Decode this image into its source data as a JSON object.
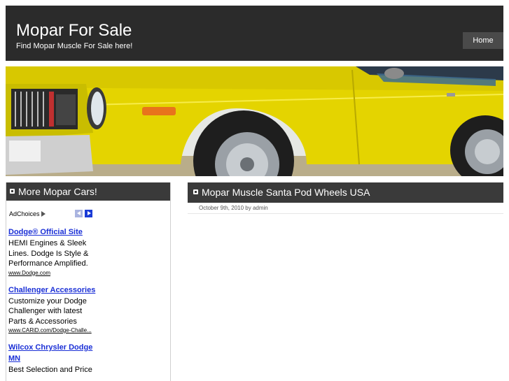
{
  "header": {
    "site_title": "Mopar For Sale",
    "site_description": "Find Mopar Muscle For Sale here!",
    "nav": {
      "home": "Home"
    }
  },
  "sidebar": {
    "heading": "More Mopar Cars!",
    "adchoices_label": "AdChoices",
    "ads": [
      {
        "title": "Dodge® Official Site",
        "body": "HEMI Engines & Sleek Lines. Dodge Is Style & Performance Amplified.",
        "url": "www.Dodge.com"
      },
      {
        "title": "Challenger Accessories",
        "body": "Customize your Dodge Challenger with latest Parts & Accessories",
        "url": "www.CARiD.com/Dodge-Challe..."
      },
      {
        "title": "Wilcox Chrysler Dodge MN",
        "body": "Best Selection and Price",
        "url": ""
      }
    ]
  },
  "post": {
    "title": "Mopar Muscle Santa Pod Wheels USA",
    "meta": "October 9th, 2010 by admin"
  },
  "colors": {
    "header_bg": "#2b2b2b",
    "nav_bg": "#4a4a4a",
    "box_head_bg": "#3a3a3a",
    "ad_link": "#1a2fd6",
    "car_yellow": "#e4d400"
  }
}
